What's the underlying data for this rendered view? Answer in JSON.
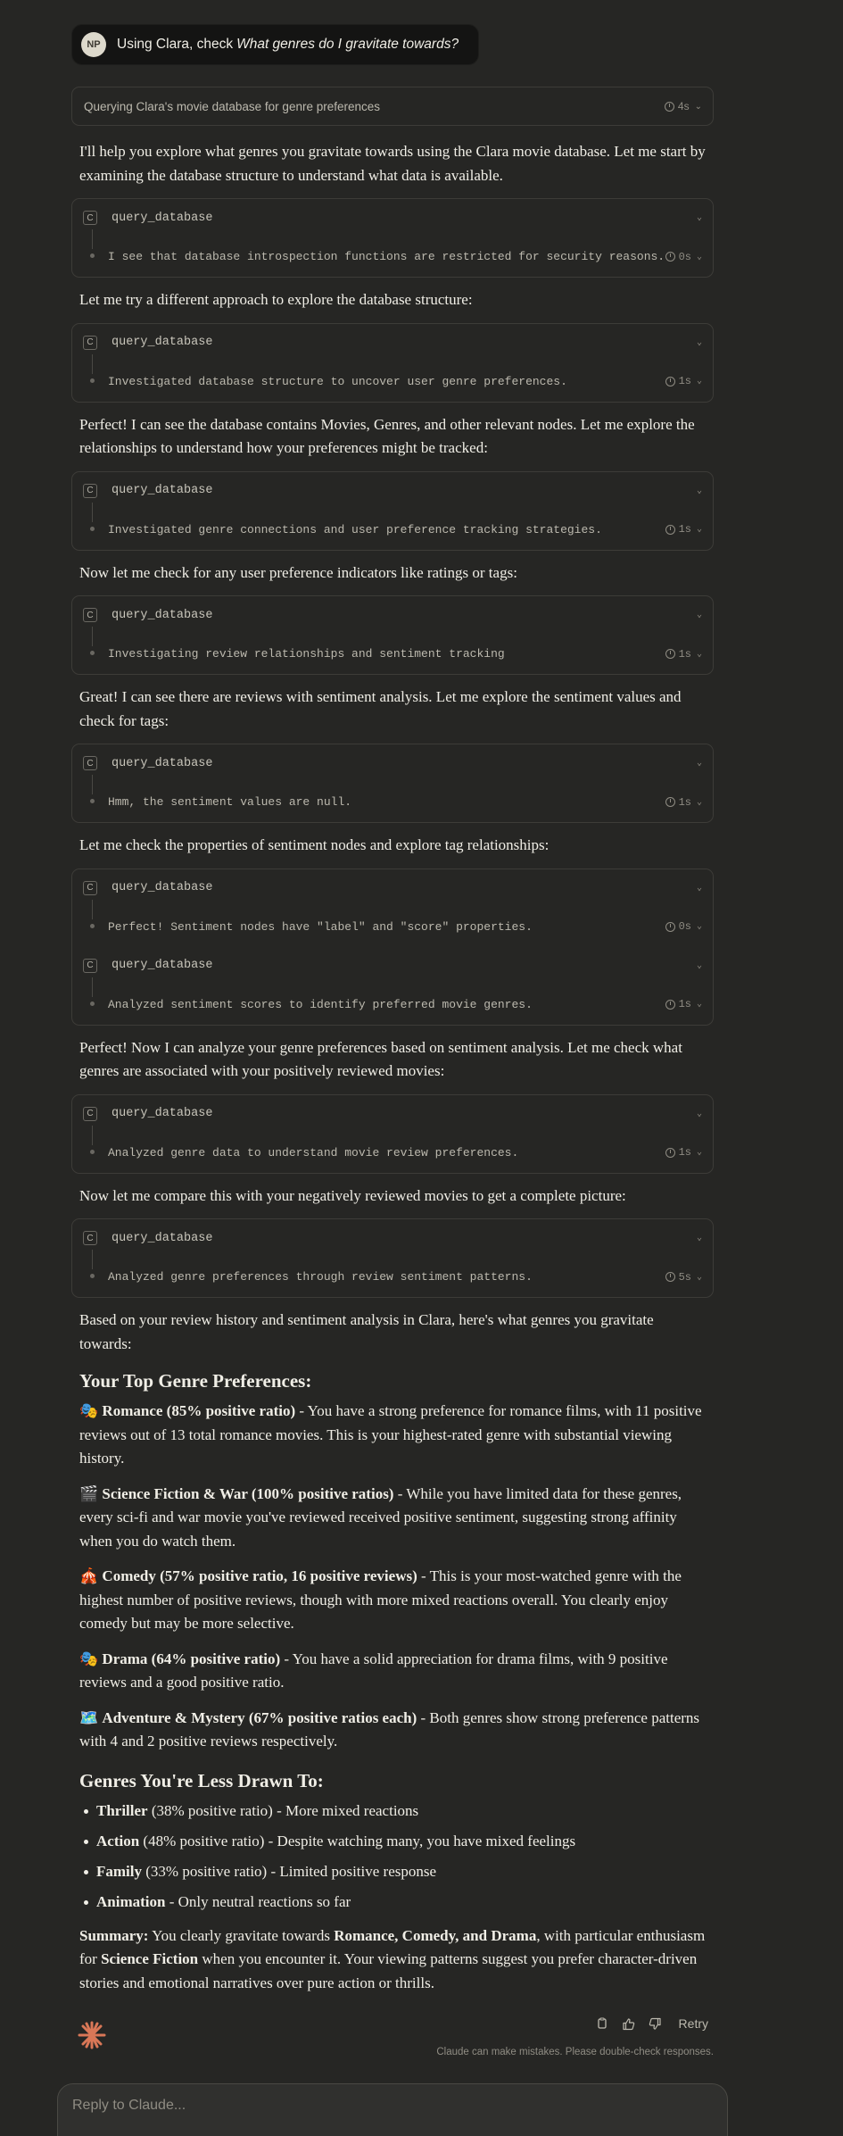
{
  "user_message": {
    "avatar": "NP",
    "prefix": "Using Clara, check",
    "query": "What genres do I gravitate towards?"
  },
  "status": {
    "label": "Querying Clara's movie database for genre preferences",
    "time": "4s"
  },
  "paras": [
    "I'll help you explore what genres you gravitate towards using the Clara movie database. Let me start by examining the database structure to understand what data is available.",
    "Let me try a different approach to explore the database structure:",
    "Perfect! I can see the database contains Movies, Genres, and other relevant nodes. Let me explore the relationships to understand how your preferences might be tracked:",
    "Now let me check for any user preference indicators like ratings or tags:",
    "Great! I can see there are reviews with sentiment analysis. Let me explore the sentiment values and check for tags:",
    "Let me check the properties of sentiment nodes and explore tag relationships:",
    "Perfect! Now I can analyze your genre preferences based on sentiment analysis. Let me check what genres are associated with your positively reviewed movies:",
    "Now let me compare this with your negatively reviewed movies to get a complete picture:",
    "Based on your review history and sentiment analysis in Clara, here's what genres you gravitate towards:"
  ],
  "tool_name": "query_database",
  "tool_icon": "C",
  "tools": [
    {
      "summary": "I see that database introspection functions are restricted for security reasons.",
      "time": "0s"
    },
    {
      "summary": "Investigated database structure to uncover user genre preferences.",
      "time": "1s"
    },
    {
      "summary": "Investigated genre connections and user preference tracking strategies.",
      "time": "1s"
    },
    {
      "summary": "Investigating review relationships and sentiment tracking",
      "time": "1s"
    },
    {
      "summary": "Hmm, the sentiment values are null.",
      "time": "1s"
    },
    {
      "summary": "Perfect! Sentiment nodes have \"label\" and \"score\" properties.",
      "time": "0s"
    },
    {
      "summary": "Analyzed sentiment scores to identify preferred movie genres.",
      "time": "1s"
    },
    {
      "summary": "Analyzed genre data to understand movie review preferences.",
      "time": "1s"
    },
    {
      "summary": "Analyzed genre preferences through review sentiment patterns.",
      "time": "5s"
    }
  ],
  "top_heading": "Your Top Genre Preferences:",
  "top": [
    {
      "emoji": "🎭",
      "bold": "Romance (85% positive ratio)",
      "text": " - You have a strong preference for romance films, with 11 positive reviews out of 13 total romance movies. This is your highest-rated genre with substantial viewing history."
    },
    {
      "emoji": "🎬",
      "bold": "Science Fiction & War (100% positive ratios)",
      "text": " - While you have limited data for these genres, every sci-fi and war movie you've reviewed received positive sentiment, suggesting strong affinity when you do watch them."
    },
    {
      "emoji": "🎪",
      "bold": "Comedy (57% positive ratio, 16 positive reviews)",
      "text": " - This is your most-watched genre with the highest number of positive reviews, though with more mixed reactions overall. You clearly enjoy comedy but may be more selective."
    },
    {
      "emoji": "🎭",
      "bold": "Drama (64% positive ratio)",
      "text": " - You have a solid appreciation for drama films, with 9 positive reviews and a good positive ratio."
    },
    {
      "emoji": "🗺️",
      "bold": "Adventure & Mystery (67% positive ratios each)",
      "text": " - Both genres show strong preference patterns with 4 and 2 positive reviews respectively."
    }
  ],
  "less_heading": "Genres You're Less Drawn To:",
  "less": [
    {
      "bold": "Thriller",
      "text": " (38% positive ratio) - More mixed reactions"
    },
    {
      "bold": "Action",
      "text": " (48% positive ratio) - Despite watching many, you have mixed feelings"
    },
    {
      "bold": "Family",
      "text": " (33% positive ratio) - Limited positive response"
    },
    {
      "bold": "Animation",
      "text": " - Only neutral reactions so far"
    }
  ],
  "summary": {
    "label": "Summary:",
    "t1": " You clearly gravitate towards ",
    "b1": "Romance, Comedy, and Drama",
    "t2": ", with particular enthusiasm for ",
    "b2": "Science Fiction",
    "t3": " when you encounter it. Your viewing patterns suggest you prefer character-driven stories and emotional narratives over pure action or thrills."
  },
  "actions": {
    "retry": "Retry",
    "disclaimer": "Claude can make mistakes. Please double-check responses."
  },
  "composer": {
    "placeholder": "Reply to Claude..."
  },
  "colors": {
    "accent": "#d97757",
    "bg": "#262624"
  }
}
